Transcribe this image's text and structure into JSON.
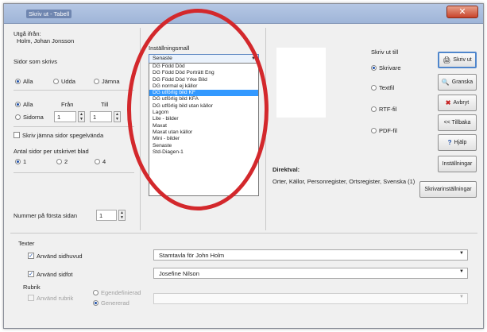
{
  "window": {
    "title": "Skriv ut - Tabell",
    "close_glyph": "✕"
  },
  "left": {
    "source_label": "Utgå ifrån:",
    "source_value": "Holm, Johan Jonsson",
    "pages_label": "Sidor som skrivs",
    "page_radios": [
      {
        "label": "Alla",
        "checked": true
      },
      {
        "label": "Udda",
        "checked": false
      },
      {
        "label": "Jämna",
        "checked": false
      }
    ],
    "range_all": "Alla",
    "range_pages": "Sidorna",
    "from_label": "Från",
    "to_label": "Till",
    "from_value": "1",
    "to_value": "1",
    "mirror_label": "Skriv jämna sidor spegelvända",
    "per_sheet_label": "Antal sidor per utskrivet blad",
    "per_sheet_options": [
      {
        "label": "1",
        "checked": true
      },
      {
        "label": "2",
        "checked": false
      },
      {
        "label": "4",
        "checked": false
      }
    ],
    "first_page_label": "Nummer på första sidan",
    "first_page_value": "1"
  },
  "template": {
    "label": "Inställningsmall",
    "selected": "Senaste",
    "options": [
      "DG Född Död",
      "DG Född Död Porträtt Eng",
      "DG Född Död Yrke Bild",
      "DG normal ej källor",
      "DG utförlig bild KF",
      "DG utförlig bild KFA",
      "DG utförlig bild utan källor",
      "Lagom",
      "Lite - bilder",
      "Maxat",
      "Maxat utan källor",
      "Mini - bilder",
      "Senaste",
      "Std-Diagen-1"
    ],
    "highlighted_index": 4
  },
  "output": {
    "label": "Skriv ut till",
    "options": [
      {
        "label": "Skrivare",
        "checked": true
      },
      {
        "label": "Textfil",
        "checked": false
      },
      {
        "label": "RTF-fil",
        "checked": false
      },
      {
        "label": "PDF-fil",
        "checked": false
      }
    ]
  },
  "direct": {
    "label": "Direktval:",
    "value": "Orter, Källor, Personregister, Ortsregister, Svenska (1)"
  },
  "buttons": {
    "print": "Skriv ut",
    "preview": "Granska",
    "cancel": "Avbryt",
    "back": "<< Tillbaka",
    "help": "Hjälp",
    "settings": "Inställningar",
    "printer_settings": "Skrivarinställningar"
  },
  "texts": {
    "section_label": "Texter",
    "header_check": "Använd sidhuvud",
    "header_value": "Stamtavla för John Holm",
    "footer_check": "Använd sidfot",
    "footer_value": "Josefine Nilson",
    "heading_label": "Rubrik",
    "heading_check": "Använd rubrik",
    "heading_own": "Egendefinierad",
    "heading_generated": "Genererad"
  },
  "colors": {
    "accent": "#3399ff",
    "annotation_circle": "#d3282c"
  }
}
